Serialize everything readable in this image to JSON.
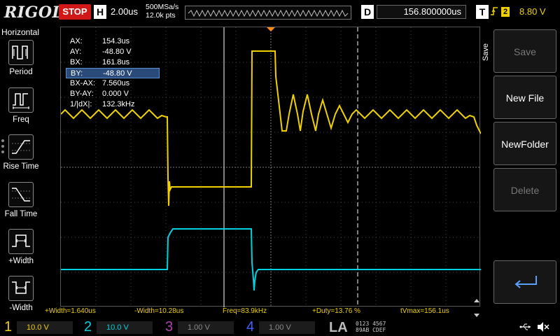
{
  "topbar": {
    "brand": "RIGOL",
    "run_state": "STOP",
    "timebase_letter": "H",
    "timebase": "2.00us",
    "sample_rate": "500MSa/s",
    "memory_depth": "12.0k pts",
    "delay_letter": "D",
    "delay": "156.800000us",
    "trigger_letter": "T",
    "trigger_icon": "rising-edge-icon",
    "trigger_source": "2",
    "trigger_level": "8.80 V"
  },
  "left_panel": {
    "title": "Horizontal",
    "items": [
      {
        "label": "Period",
        "icon": "period-icon"
      },
      {
        "label": "Freq",
        "icon": "freq-icon"
      },
      {
        "label": "Rise Time",
        "icon": "rise-time-icon"
      },
      {
        "label": "Fall Time",
        "icon": "fall-time-icon"
      },
      {
        "label": "+Width",
        "icon": "pos-width-icon"
      },
      {
        "label": "-Width",
        "icon": "neg-width-icon"
      }
    ]
  },
  "cursors": [
    {
      "key": "AX:",
      "value": "154.3us",
      "selected": false
    },
    {
      "key": "AY:",
      "value": "-48.80 V",
      "selected": false
    },
    {
      "key": "BX:",
      "value": "161.8us",
      "selected": false
    },
    {
      "key": "BY:",
      "value": "-48.80 V",
      "selected": true
    },
    {
      "key": "BX-AX:",
      "value": "7.560us",
      "selected": false
    },
    {
      "key": "BY-AY:",
      "value": "0.000 V",
      "selected": false
    },
    {
      "key": "1/|dX|:",
      "value": "132.3kHz",
      "selected": false
    }
  ],
  "right_panel": {
    "section_label": "Save",
    "buttons": [
      {
        "label": "Save",
        "enabled": false
      },
      {
        "label": "New File",
        "enabled": true
      },
      {
        "label": "NewFolder",
        "enabled": true
      },
      {
        "label": "Delete",
        "enabled": false
      }
    ],
    "enter_icon": "enter-arrow-icon"
  },
  "measurements": [
    {
      "text": "+Width=1.640us"
    },
    {
      "text": "-Width=10.28us"
    },
    {
      "text": "Freq=83.9kHz"
    },
    {
      "text": "+Duty=13.76 %"
    },
    {
      "text": "tVmax=156.1us"
    }
  ],
  "channels": [
    {
      "number": "1",
      "scale": "10.0 V",
      "color": "#f0d000",
      "active": true
    },
    {
      "number": "2",
      "scale": "10.0 V",
      "color": "#00d0e0",
      "active": true
    },
    {
      "number": "3",
      "scale": "1.00 V",
      "color": "#c040c0",
      "active": false
    },
    {
      "number": "4",
      "scale": "1.00 V",
      "color": "#4060ff",
      "active": false
    }
  ],
  "la": {
    "label": "LA",
    "row1": "0123 4567",
    "row2": "89AB CDEF"
  },
  "status_icons": [
    "usb-icon",
    "speaker-muted-icon"
  ],
  "waveform_markers": {
    "ch1_marker": "1",
    "ch2_marker": "2"
  },
  "colors": {
    "ch1": "#f0d000",
    "ch2": "#00d0e0",
    "stop": "#d01818",
    "marker_orange": "#ff8a1a"
  }
}
